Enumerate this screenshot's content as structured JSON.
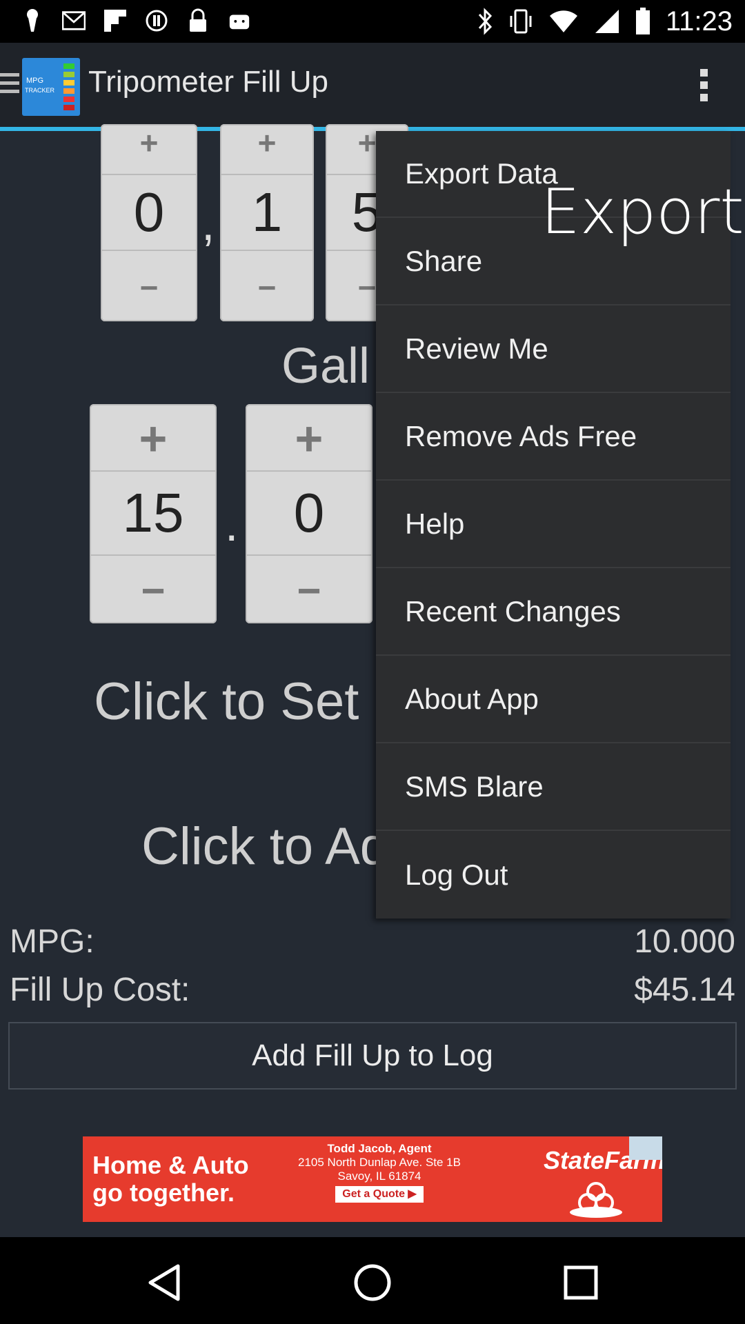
{
  "status_bar": {
    "time": "11:23",
    "left_icons": [
      "keyhole-icon",
      "mail-icon",
      "flipboard-icon",
      "stop-icon",
      "lock-icon",
      "android-icon"
    ],
    "right_icons": [
      "bluetooth-icon",
      "vibrate-icon",
      "wifi-icon",
      "signal-icon",
      "battery-icon"
    ]
  },
  "app_bar": {
    "title": "Tripometer Fill Up",
    "logo_text": "MPG TRACKER",
    "menu_icon": "overflow-menu-icon"
  },
  "odometer": {
    "digits": [
      "0",
      "1",
      "5"
    ],
    "separator": ","
  },
  "gallons": {
    "label_partial": "Gall",
    "whole": "15",
    "decimal": "0",
    "separator": "."
  },
  "buttons": {
    "plus": "+",
    "minus": "−"
  },
  "set_label_partial": "Click to Set",
  "add_label_partial": "Click to Ad",
  "stats": {
    "mpg_label": "MPG:",
    "mpg_value": "10.000",
    "cost_label": "Fill Up Cost:",
    "cost_value": "$45.14"
  },
  "add_button": "Add Fill Up to Log",
  "ad": {
    "headline": "Home & Auto go together.",
    "agent": "Todd Jacob, Agent",
    "address1": "2105 North Dunlap Ave. Ste 1B",
    "address2": "Savoy, IL 61874",
    "cta": "Get a Quote ▶",
    "brand": "StateFarm"
  },
  "menu": {
    "items": [
      "Export Data",
      "Share",
      "Review Me",
      "Remove Ads Free",
      "Help",
      "Recent Changes",
      "About App",
      "SMS Blare",
      "Log Out"
    ]
  },
  "tooltip": "Export",
  "nav": [
    "back-icon",
    "home-icon",
    "recents-icon"
  ]
}
